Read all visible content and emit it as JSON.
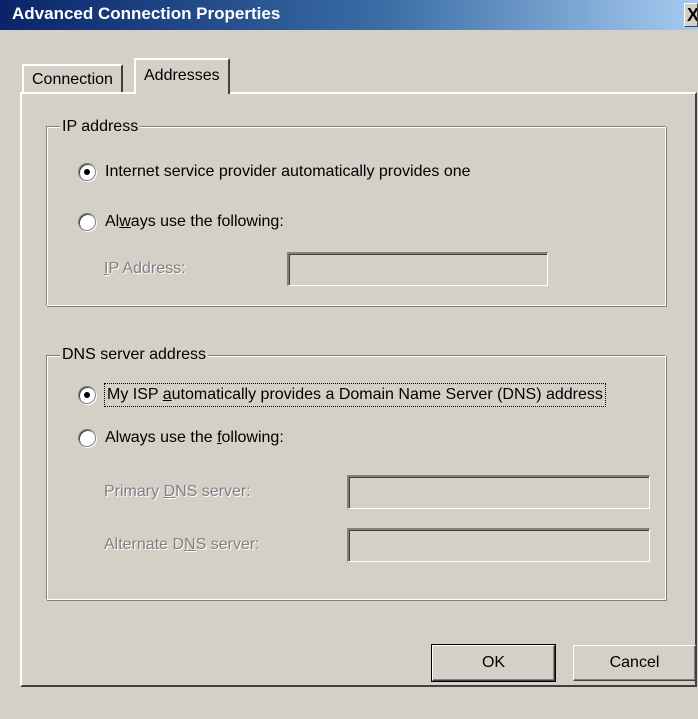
{
  "window": {
    "title": "Advanced Connection Properties",
    "close_glyph": "X"
  },
  "tabs": [
    {
      "label": "Connection",
      "active": false
    },
    {
      "label": "Addresses",
      "active": true
    }
  ],
  "ip_group": {
    "legend": "IP address",
    "option_auto": {
      "label": "Internet service provider automatically provides one",
      "checked": true
    },
    "option_manual": {
      "label_pre": "Al",
      "label_key": "w",
      "label_post": "ays use the following:",
      "checked": false
    },
    "ip_field": {
      "label_key": "I",
      "label_post": "P Address:",
      "value": "",
      "enabled": false
    }
  },
  "dns_group": {
    "legend": "DNS server address",
    "option_auto": {
      "label_pre": "My ISP ",
      "label_key": "a",
      "label_post": "utomatically provides a Domain Name Server (DNS) address",
      "checked": true
    },
    "option_manual": {
      "label_pre": "Always use the ",
      "label_key": "f",
      "label_post": "ollowing:",
      "checked": false
    },
    "primary": {
      "label_pre": "Primary ",
      "label_key": "D",
      "label_post": "NS server:",
      "value": "",
      "enabled": false
    },
    "alternate": {
      "label_pre": "Alternate D",
      "label_key": "N",
      "label_post": "S server:",
      "value": "",
      "enabled": false
    }
  },
  "buttons": {
    "ok": "OK",
    "cancel": "Cancel"
  },
  "colors": {
    "face": "#d4d0c8",
    "title_start": "#0a246a",
    "title_end": "#a6caf0",
    "disabled_text": "#808080"
  }
}
